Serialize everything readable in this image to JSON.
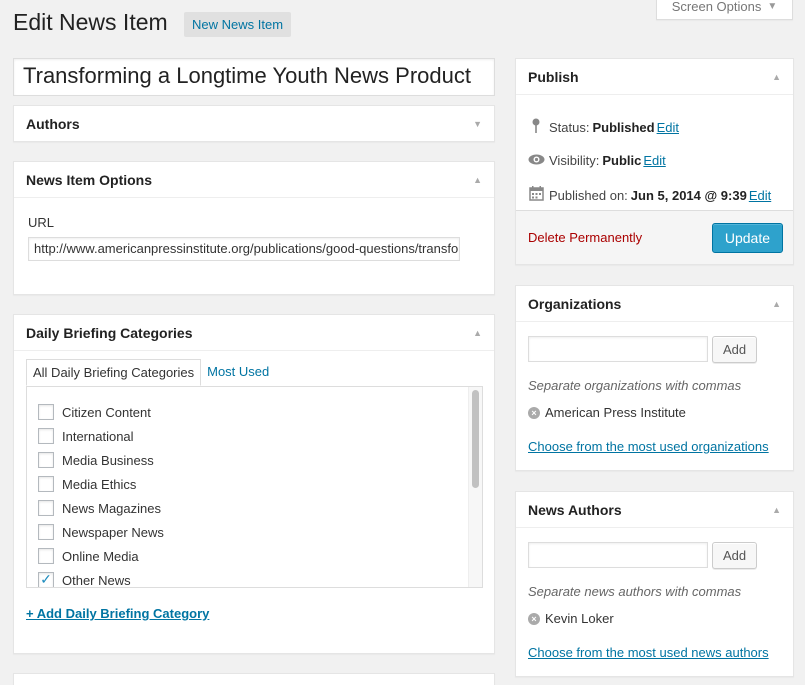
{
  "header": {
    "title": "Edit News Item",
    "add_new_label": "New News Item",
    "screen_options_label": "Screen Options"
  },
  "post": {
    "title_value": "Transforming a Longtime Youth News Product"
  },
  "authors_box": {
    "title": "Authors"
  },
  "news_item_options": {
    "title": "News Item Options",
    "url_label": "URL",
    "url_value": "http://www.americanpressinstitute.org/publications/good-questions/transforming-a-longtime-youth-news-product"
  },
  "categories": {
    "title": "Daily Briefing Categories",
    "tabs": [
      {
        "label": "All Daily Briefing Categories"
      },
      {
        "label": "Most Used"
      }
    ],
    "items": [
      {
        "label": "Citizen Content",
        "checked": false
      },
      {
        "label": "International",
        "checked": false
      },
      {
        "label": "Media Business",
        "checked": false
      },
      {
        "label": "Media Ethics",
        "checked": false
      },
      {
        "label": "News Magazines",
        "checked": false
      },
      {
        "label": "Newspaper News",
        "checked": false
      },
      {
        "label": "Online Media",
        "checked": false
      },
      {
        "label": "Other News",
        "checked": true
      }
    ],
    "add_link": "+ Add Daily Briefing Category"
  },
  "publish": {
    "title": "Publish",
    "status_label": "Status:",
    "status_value": "Published",
    "visibility_label": "Visibility:",
    "visibility_value": "Public",
    "published_label": "Published on:",
    "published_value": "Jun 5, 2014 @ 9:39",
    "edit_label": "Edit",
    "delete_label": "Delete Permanently",
    "update_label": "Update"
  },
  "organizations": {
    "title": "Organizations",
    "add_label": "Add",
    "howto": "Separate organizations with commas",
    "tags": [
      "American Press Institute"
    ],
    "most_used_link": "Choose from the most used organizations"
  },
  "news_authors": {
    "title": "News Authors",
    "add_label": "Add",
    "howto": "Separate news authors with commas",
    "tags": [
      "Kevin Loker"
    ],
    "most_used_link": "Choose from the most used news authors"
  },
  "colors": {
    "link": "#0074a2",
    "primary_button": "#2ea2cc",
    "delete": "#aa0000",
    "background": "#f1f1f1"
  },
  "icons": {
    "toggle_up": "▲",
    "toggle_down": "▼",
    "status": "pin-icon",
    "visibility": "eye-icon",
    "calendar": "calendar-icon",
    "remove_tag": "x-circle-icon",
    "checkmark": "✓"
  }
}
